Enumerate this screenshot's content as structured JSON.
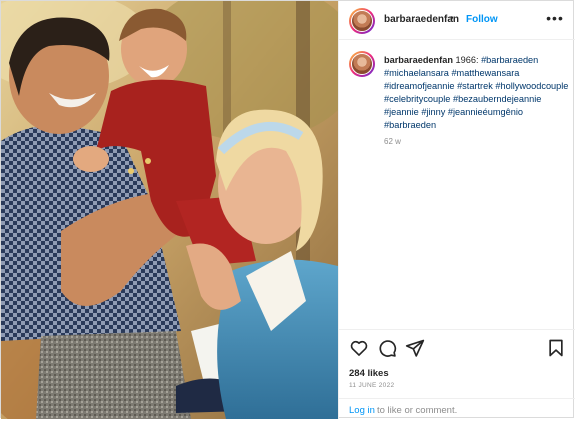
{
  "post": {
    "username": "barbaraedenfan",
    "separator": "•",
    "follow_label": "Follow",
    "more_glyph": "•••",
    "photo_alt": "Vintage family photo",
    "caption": {
      "username": "barbaraedenfan",
      "lead_text": "1966:",
      "hashtags": [
        "#barbaraeden",
        "#michaelansara",
        "#matthewansara",
        "#idreamofjeannie",
        "#startrek",
        "#hollywoodcouple",
        "#celebritycouple",
        "#bezauberndejeannie",
        "#jeannie",
        "#jinny",
        "#jeannieéumgênio",
        "#barbraeden"
      ]
    },
    "age": "62 w",
    "icons": [
      "heart-icon",
      "comment-icon",
      "share-icon",
      "bookmark-icon"
    ],
    "likes": "284 likes",
    "date": "11 JUNE 2022",
    "login_link": "Log in",
    "login_rest": "to like or comment."
  }
}
